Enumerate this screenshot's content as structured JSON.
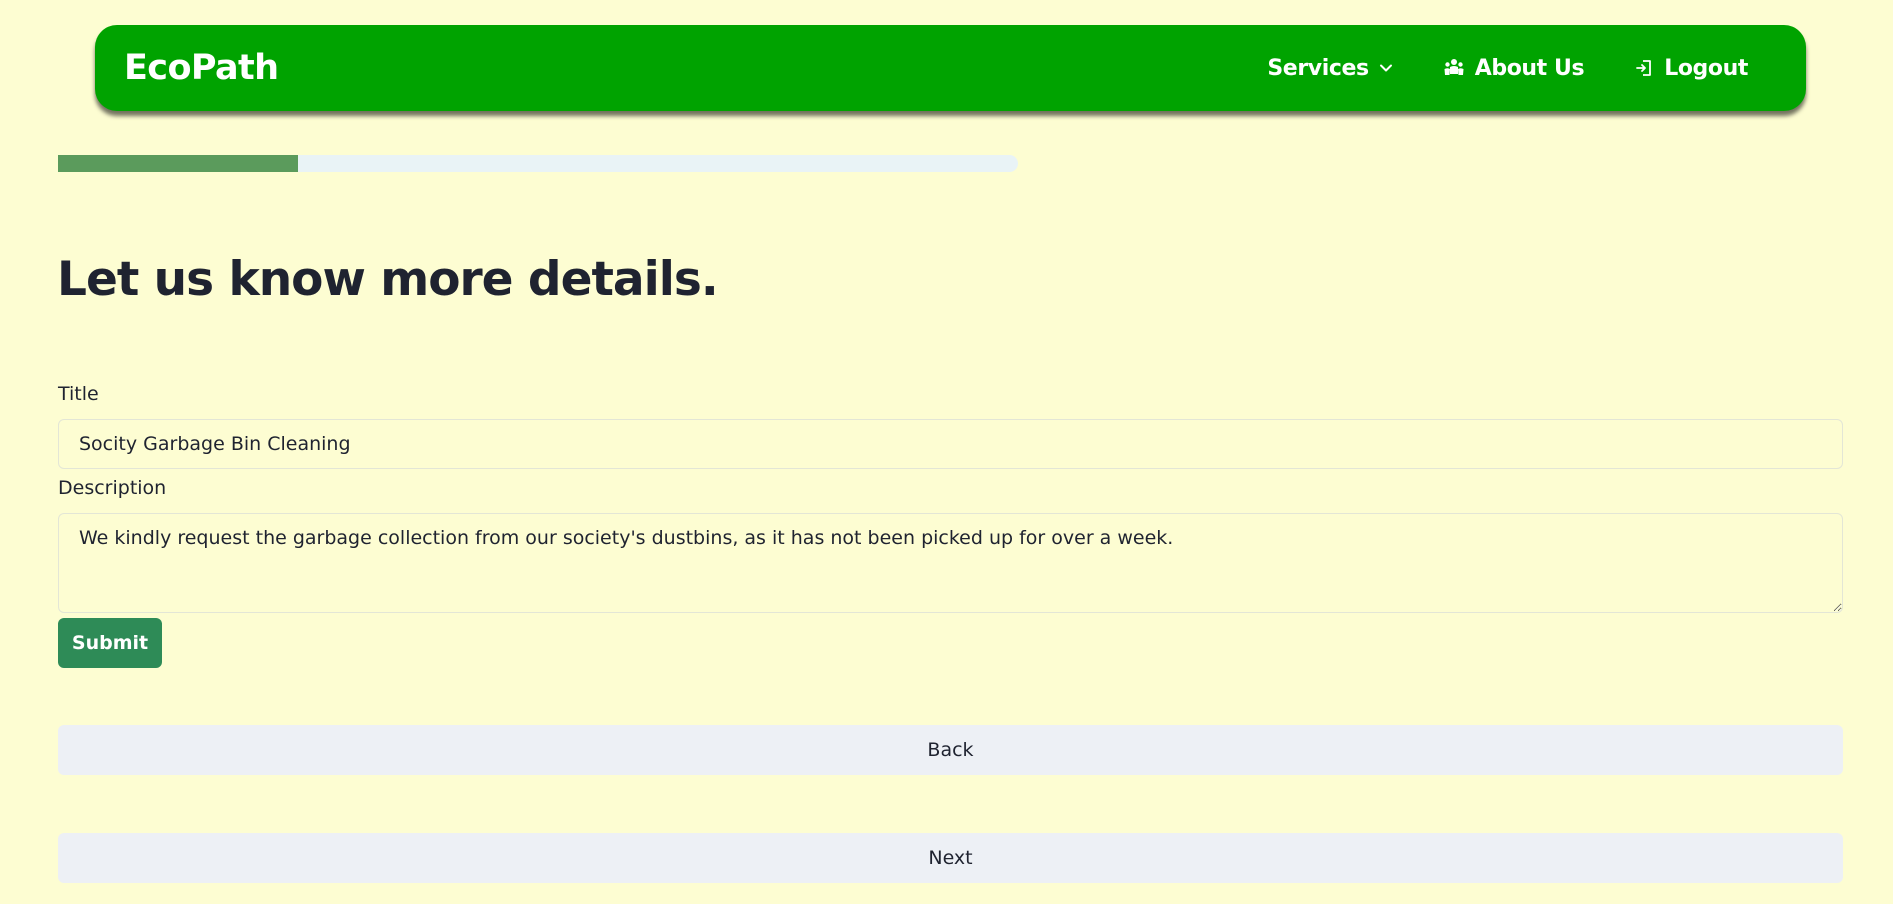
{
  "navbar": {
    "brand": "EcoPath",
    "items": [
      {
        "label": "Services",
        "icon": "chevron-down-icon"
      },
      {
        "label": "About Us",
        "icon": "people-icon"
      },
      {
        "label": "Logout",
        "icon": "logout-icon"
      }
    ]
  },
  "progress": {
    "fraction": 0.25,
    "fill_color": "#5b9b5c",
    "track_color": "#e9f3f6"
  },
  "form": {
    "heading": "Let us know more details.",
    "title_label": "Title",
    "title_value": "Socity Garbage Bin Cleaning",
    "description_label": "Description",
    "description_value": "We kindly request the garbage collection from our society's dustbins, as it has not been picked up for over a week.",
    "submit_label": "Submit"
  },
  "navigation": {
    "back_label": "Back",
    "next_label": "Next"
  },
  "colors": {
    "background": "#fdfdd2",
    "navbar": "#00a300",
    "submit": "#2e8b57",
    "secondary_button": "#edf0f5"
  }
}
